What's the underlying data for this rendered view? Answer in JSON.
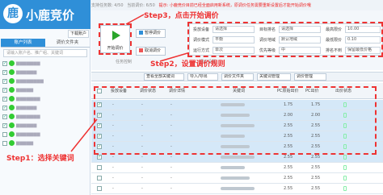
{
  "app": {
    "title": "小鹿竞价",
    "icon_glyph": "鹿",
    "download_label": "下载账户"
  },
  "info": {
    "plan_label": "支持任务数: 4/50",
    "running_label": "当前调价: 6/50",
    "notice": "提示: 小鹿竞价目前已经全面启用新系统，原调价任务需要重新设置后才能开始调价哦"
  },
  "sidebar": {
    "tabs": [
      {
        "label": "账户列表",
        "active": true
      },
      {
        "label": "调价文件夹",
        "active": false
      }
    ],
    "search_placeholder": "请输入账户名、推广组、关键词",
    "items": [
      {
        "label": "▆▆▆▆▆▆▆",
        "checked": true
      },
      {
        "label": "▆▆▆▆▆▆",
        "checked": true
      },
      {
        "label": "▆▆▆▆▆▆▆▆",
        "checked": true
      },
      {
        "label": "▆▆▆▆▆",
        "checked": true
      },
      {
        "label": "▆▆▆▆▆▆▆",
        "checked": true
      },
      {
        "label": "▆▆▆▆▆▆",
        "checked": true
      },
      {
        "label": "▆▆▆▆▆▆▆",
        "checked": true
      },
      {
        "label": "▆▆▆▆▆▆",
        "checked": true
      },
      {
        "label": "▆▆▆▆▆▆▆",
        "checked": false
      },
      {
        "label": "▆▆▆▆▆",
        "checked": false
      }
    ]
  },
  "toolbar": {
    "start_label": "开始调价",
    "pause_label": "暂停调价",
    "cancel_label": "取消调价",
    "group_task": "任务控制",
    "group_settings": "调价设置"
  },
  "settings": {
    "device_label": "投放设备",
    "device_value": "请选择",
    "target_label": "目标排名",
    "target_value": "请选择",
    "max_bid_label": "最高限价",
    "max_bid_value": "10.00",
    "mode_label": "调价模式",
    "mode_value": "平衡",
    "region_label": "调价地域",
    "region_value": "默认地域",
    "min_bid_label": "最低限价",
    "min_bid_value": "0.10",
    "method_label": "运行方式",
    "method_value": "单次",
    "priority_label": "优先等级",
    "priority_value": "中",
    "fallback_label": "排名不到",
    "fallback_value": "保留最低价格"
  },
  "filters": [
    "查看全部关键词",
    "导入/导出",
    "调价文件夹",
    "关键词管理",
    "调价管理"
  ],
  "table": {
    "headers": [
      "投放设备",
      "调价状态",
      "调价详情",
      "关键词",
      "PC原始出价",
      "PC出价",
      "出价状态"
    ],
    "rows": [
      {
        "checked": true,
        "device": "-",
        "status": "-",
        "detail": "-",
        "orig": "1.75",
        "bid": "1.75"
      },
      {
        "checked": true,
        "device": "-",
        "status": "-",
        "detail": "-",
        "orig": "2.00",
        "bid": "2.00"
      },
      {
        "checked": true,
        "device": "-",
        "status": "-",
        "detail": "-",
        "orig": "2.55",
        "bid": "2.55"
      },
      {
        "checked": true,
        "device": "-",
        "status": "-",
        "detail": "-",
        "orig": "2.55",
        "bid": "2.55"
      },
      {
        "checked": true,
        "device": "-",
        "status": "-",
        "detail": "-",
        "orig": "2.55",
        "bid": "2.55"
      },
      {
        "checked": true,
        "device": "-",
        "status": "-",
        "detail": "-",
        "orig": "2.55",
        "bid": "2.55"
      },
      {
        "checked": false,
        "device": "-",
        "status": "-",
        "detail": "-",
        "orig": "2.55",
        "bid": "2.55"
      },
      {
        "checked": false,
        "device": "-",
        "status": "-",
        "detail": "-",
        "orig": "2.55",
        "bid": "2.55"
      },
      {
        "checked": false,
        "device": "-",
        "status": "-",
        "detail": "-",
        "orig": "2.55",
        "bid": "2.55"
      }
    ]
  },
  "annotations": {
    "step1": "Step1：选择关键词",
    "step2": "Step2，设置调价规则",
    "step3": "Step3，点击开始调价"
  },
  "colors": {
    "accent": "#2f8fd8",
    "annotation": "#e33",
    "start": "#2aa52a"
  }
}
